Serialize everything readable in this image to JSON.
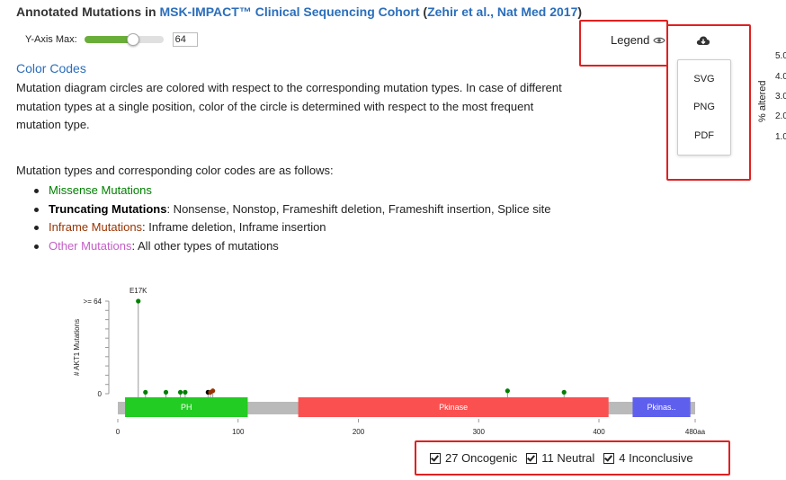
{
  "header": {
    "title_prefix": "Annotated Mutations in ",
    "study_name": "MSK-IMPACT™ Clinical Sequencing Cohort",
    "paren_open": " (",
    "citation": "Zehir et al., Nat Med 2017",
    "paren_close": ")"
  },
  "y_axis_control": {
    "label": "Y-Axis Max:",
    "slider_value": 64,
    "input_value": "64"
  },
  "color_codes": {
    "title": "Color Codes",
    "description": "Mutation diagram circles are colored with respect to the corresponding mutation types. In case of different mutation types at a single position, color of the circle is determined with respect to the most frequent mutation type.",
    "types_intro": "Mutation types and corresponding color codes are as follows:",
    "types": [
      {
        "name": "Missense Mutations",
        "detail": ""
      },
      {
        "name": "Truncating Mutations",
        "detail": ": Nonsense, Nonstop, Frameshift deletion, Frameshift insertion, Splice site"
      },
      {
        "name": "Inframe Mutations",
        "detail": ": Inframe deletion, Inframe insertion"
      },
      {
        "name": "Other Mutations",
        "detail": ": All other types of mutations"
      }
    ]
  },
  "toolbar": {
    "legend_label": "Legend",
    "download_options": [
      "SVG",
      "PNG",
      "PDF"
    ]
  },
  "side_panel": {
    "ticks": [
      "5.0",
      "4.0",
      "3.0",
      "2.0",
      "1.0"
    ],
    "axis_label": "% altered"
  },
  "lollipop": {
    "y_axis_label": "# AKT1 Mutations",
    "y_max_label": ">= 64",
    "y_zero_label": "0",
    "x_ticks": [
      "0",
      "100",
      "200",
      "300",
      "400",
      "480aa"
    ],
    "hotspot_label": "E17K",
    "domains": [
      {
        "name": "PH",
        "color": "#22cc22"
      },
      {
        "name": "Pkinase",
        "color": "#fa5050"
      },
      {
        "name": "Pkinas..",
        "color": "#5f5fee"
      }
    ],
    "colors": {
      "missense": "#008000",
      "truncating": "#000000",
      "inframe": "#993300",
      "other": "#c45ec6",
      "backbone": "#bababa"
    }
  },
  "chart_data": {
    "type": "scatter",
    "ylabel": "# AKT1 Mutations",
    "xlim": [
      0,
      480
    ],
    "ylim": [
      0,
      64
    ],
    "x_ticks": [
      "0",
      "100",
      "200",
      "300",
      "400",
      "480aa"
    ],
    "domains": [
      {
        "name": "PH",
        "start": 6,
        "end": 108
      },
      {
        "name": "Pkinase",
        "start": 150,
        "end": 408
      },
      {
        "name": "Pkinas..",
        "start": 428,
        "end": 476
      }
    ],
    "points": [
      {
        "x": 17,
        "y": 64,
        "label": "E17K",
        "type": "missense"
      },
      {
        "x": 23,
        "y": 1,
        "type": "missense"
      },
      {
        "x": 40,
        "y": 1,
        "type": "missense"
      },
      {
        "x": 52,
        "y": 1,
        "type": "missense"
      },
      {
        "x": 56,
        "y": 1,
        "type": "missense"
      },
      {
        "x": 75,
        "y": 1,
        "type": "truncating"
      },
      {
        "x": 77,
        "y": 1,
        "type": "inframe"
      },
      {
        "x": 79,
        "y": 2,
        "type": "inframe"
      },
      {
        "x": 324,
        "y": 2,
        "type": "missense"
      },
      {
        "x": 371,
        "y": 1,
        "type": "missense"
      }
    ]
  },
  "filters": {
    "oncogenic": "27 Oncogenic",
    "neutral": "11 Neutral",
    "inconclusive": "4 Inconclusive"
  }
}
